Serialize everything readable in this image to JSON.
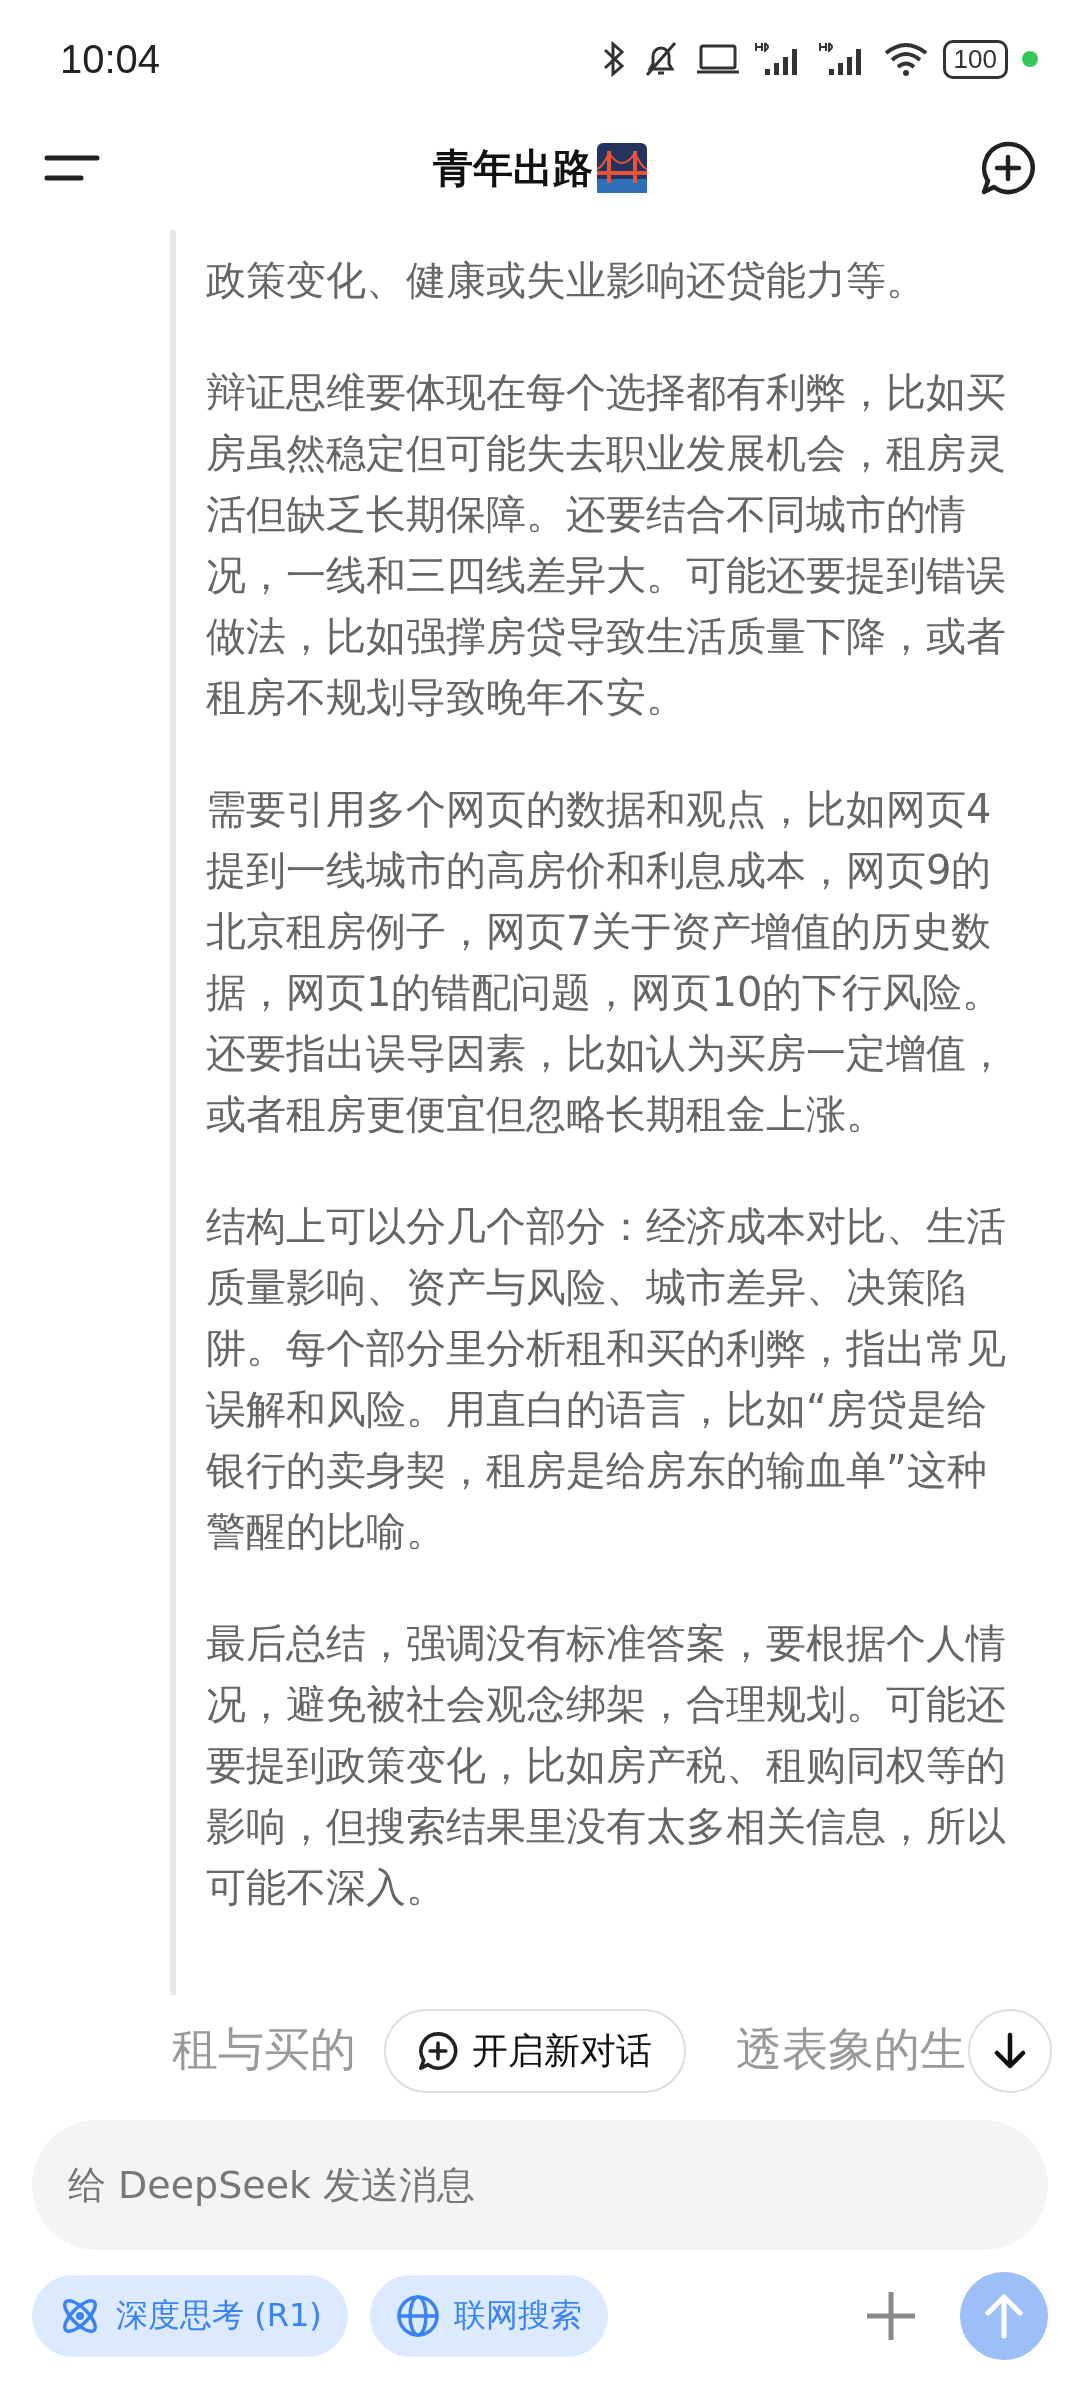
{
  "status_bar": {
    "time": "10:04",
    "battery": "100"
  },
  "header": {
    "title": "青年出路"
  },
  "thinking": [
    "政策变化、健康或失业影响还贷能力等。",
    "辩证思维要体现在每个选择都有利弊，比如买房虽然稳定但可能失去职业发展机会，租房灵活但缺乏长期保障。还要结合不同城市的情况，一线和三四线差异大。可能还要提到错误做法，比如强撑房贷导致生活质量下降，或者租房不规划导致晚年不安。",
    "需要引用多个网页的数据和观点，比如网页4提到一线城市的高房价和利息成本，网页9的北京租房例子，网页7关于资产增值的历史数据，网页1的错配问题，网页10的下行风险。还要指出误导因素，比如认为买房一定增值，或者租房更便宜但忽略长期租金上涨。",
    "结构上可以分几个部分：经济成本对比、生活质量影响、资产与风险、城市差异、决策陷阱。每个部分里分析租和买的利弊，指出常见误解和风险。用直白的语言，比如“房贷是给银行的卖身契，租房是给房东的输血单”这种警醒的比喻。",
    "最后总结，强调没有标准答案，要根据个人情况，避免被社会观念绑架，合理规划。可能还要提到政策变化，比如房产税、租购同权等的影响，但搜索结果里没有太多相关信息，所以可能不深入。"
  ],
  "answer_fragments": [
    "租与买的",
    "透表象的生"
  ],
  "new_chat_button": "开启新对话",
  "composer": {
    "placeholder": "给 DeepSeek 发送消息"
  },
  "toggles": [
    {
      "kind": "deep-think",
      "label": "深度思考 (R1)",
      "selected": true
    },
    {
      "kind": "web-search",
      "label": "联网搜索",
      "selected": true
    }
  ]
}
